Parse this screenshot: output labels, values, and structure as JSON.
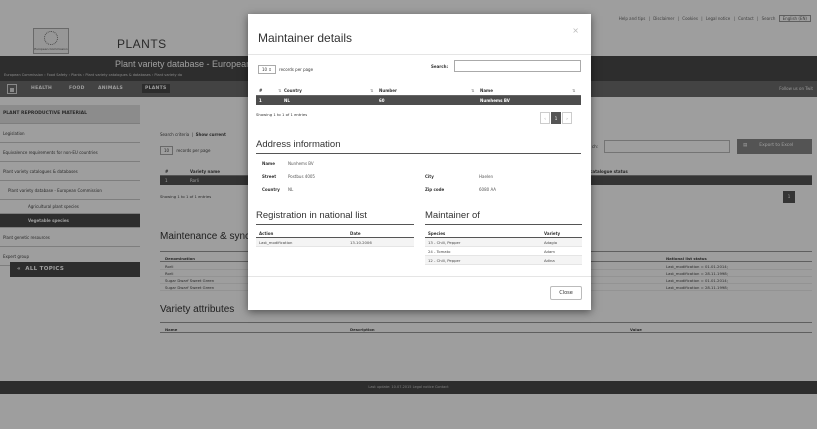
{
  "header": {
    "top_links": [
      "Help and tips",
      "|",
      "Disclaimer",
      "|",
      "Cookies",
      "|",
      "Legal notice",
      "|",
      "Contact",
      "|",
      "Search"
    ],
    "language": "English (EN)",
    "logo_text": "European Commission",
    "site_title": "PLANTS",
    "db_title": "Plant variety database - European",
    "breadcrumb": "European Commission › Food Safety › Plants › Plant variety catalogues & databases › Plant variety da"
  },
  "nav": {
    "items": [
      "HEALTH",
      "FOOD",
      "ANIMALS",
      "PLANTS"
    ],
    "right": "Follow us on Twit"
  },
  "sidebar": {
    "header": "PLANT REPRODUCTIVE MATERIAL",
    "items": [
      "Legislation",
      "Equivalence requirements for non-EU countries",
      "Plant variety catalogues & databases",
      "Plant variety database - European Commission"
    ],
    "subitems": [
      "Agricultural plant species",
      "Vegetable species"
    ],
    "items_after": [
      "Plant genetic resources",
      "Expert group"
    ],
    "all_topics": "ALL TOPICS"
  },
  "background": {
    "search_criteria": "Search criteria",
    "show_current": "Show current",
    "rpp_value": "10",
    "rpp_label": "records per page",
    "search_label": "ch:",
    "export_label": "Export to Excel",
    "table_cols": [
      "#",
      "Variety name",
      "catalogue status"
    ],
    "table_row": [
      "1",
      "Rorli"
    ],
    "showing": "Showing 1 to 1 of 1 entries",
    "page": "1",
    "maint_heading": "Maintenance & sync",
    "maint_cols": [
      "Denomination",
      "National list status"
    ],
    "maint_rows": [
      {
        "name": "Rorli",
        "status": "Last_modification = 01.01.2014;"
      },
      {
        "name": "Rorli",
        "status": "Last_modification = 28.11.1998;"
      },
      {
        "name": "Sugar Dwarf Sweet Green",
        "status": "Last_modification = 01.01.2014;"
      },
      {
        "name": "Sugar Dwarf Sweet Green",
        "status": "Last_modification = 28.11.1998;"
      }
    ],
    "variety_heading": "Variety attributes",
    "variety_cols": [
      "Name",
      "Description",
      "Value"
    ],
    "footer": "Last update: 10.07.2015  Legal notice  Contact"
  },
  "modal": {
    "title": "Maintainer details",
    "close_x": "×",
    "rpp_value": "10",
    "rpp_label": "records per page",
    "search_label": "Search:",
    "search_value": "",
    "cols": [
      "#",
      "Country",
      "Number",
      "Name"
    ],
    "row": [
      "1",
      "NL",
      "60",
      "Numhems BV"
    ],
    "showing": "Showing 1 to 1 of 1 entries",
    "pager": {
      "prev": "‹",
      "current": "1",
      "next": "›"
    },
    "address_heading": "Address information",
    "address": {
      "name_label": "Name",
      "name_value": "Nunhems BV",
      "street_label": "Street",
      "street_value": "Postbus 4005",
      "city_label": "City",
      "city_value": "Haelen",
      "country_label": "Country",
      "country_value": "NL",
      "zip_label": "Zip code",
      "zip_value": "6080 AA"
    },
    "reg_heading": "Registration in national list",
    "reg_cols": [
      "Action",
      "Date"
    ],
    "reg_rows": [
      {
        "action": "Last_modification",
        "date": "13.10.2006"
      }
    ],
    "maint_heading": "Maintainer of",
    "maint_cols": [
      "Species",
      "Variety"
    ],
    "maint_rows": [
      {
        "species": "13 - Chili, Pepper",
        "variety": "Adagio"
      },
      {
        "species": "24 - Tomato",
        "variety": "Adam"
      },
      {
        "species": "12 - Chili, Pepper",
        "variety": "Adina"
      }
    ],
    "close_label": "Close"
  }
}
